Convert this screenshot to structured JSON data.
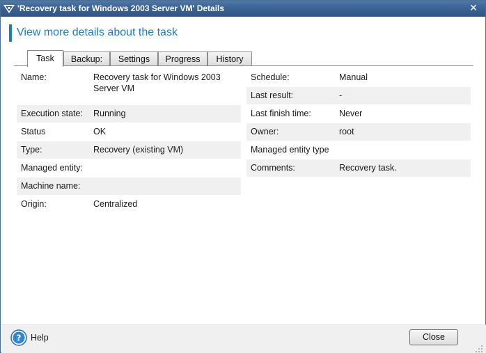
{
  "window": {
    "title": "'Recovery task for Windows 2003 Server VM' Details",
    "close_glyph": "✕"
  },
  "header": {
    "text": "View more details about the task"
  },
  "tabs": [
    {
      "label": "Task",
      "active": true
    },
    {
      "label": "Backup:",
      "active": false
    },
    {
      "label": "Settings",
      "active": false
    },
    {
      "label": "Progress",
      "active": false
    },
    {
      "label": "History",
      "active": false
    }
  ],
  "left_rows": [
    {
      "label": "Name:",
      "value": "Recovery task for Windows 2003 Server VM"
    },
    {
      "label": "Execution state:",
      "value": "Running"
    },
    {
      "label": "Status",
      "value": "OK"
    },
    {
      "label": "Type:",
      "value": "Recovery (existing VM)"
    },
    {
      "label": "Managed entity:",
      "value": ""
    },
    {
      "label": "Machine name:",
      "value": ""
    },
    {
      "label": "Origin:",
      "value": "Centralized"
    }
  ],
  "right_rows": [
    {
      "label": "Schedule:",
      "value": "Manual"
    },
    {
      "label": "Last result:",
      "value": "-"
    },
    {
      "label": "Last finish time:",
      "value": "Never"
    },
    {
      "label": "Owner:",
      "value": "root"
    },
    {
      "label": "Managed entity type",
      "value": ""
    },
    {
      "label": "Comments:",
      "value": "Recovery task."
    }
  ],
  "footer": {
    "help_label": "Help",
    "close_label": "Close"
  },
  "colors": {
    "accent": "#1f79c4",
    "titlebar": "#3c6396",
    "row_shade": "#f0f0f0"
  }
}
